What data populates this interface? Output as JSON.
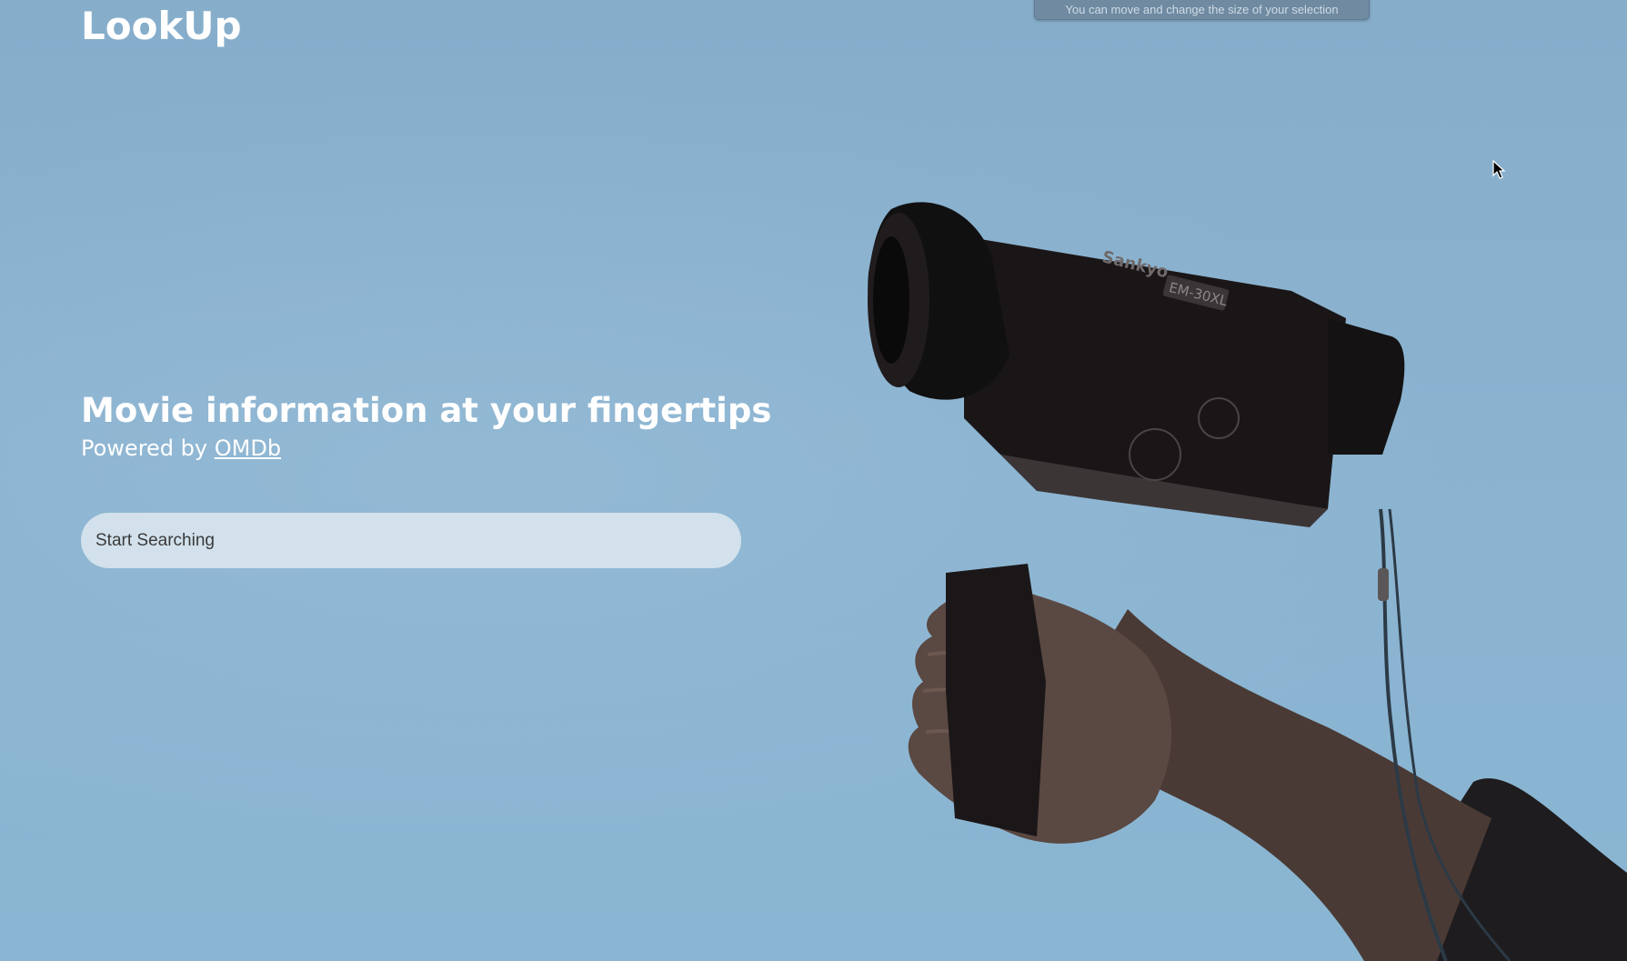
{
  "app": {
    "logo": "LookUp"
  },
  "overlay": {
    "tooltip": "You can move and change the size of your selection"
  },
  "hero": {
    "headline": "Movie information at your fingertips",
    "powered_prefix": "Powered by ",
    "powered_link": "OMDb"
  },
  "search": {
    "placeholder": "Start Searching"
  },
  "image": {
    "camera_brand": "Sankyo",
    "camera_model": "EM-30XL"
  },
  "colors": {
    "background": "#8bb3d0",
    "text": "#ffffff",
    "search_bg": "#d2e1eb"
  }
}
